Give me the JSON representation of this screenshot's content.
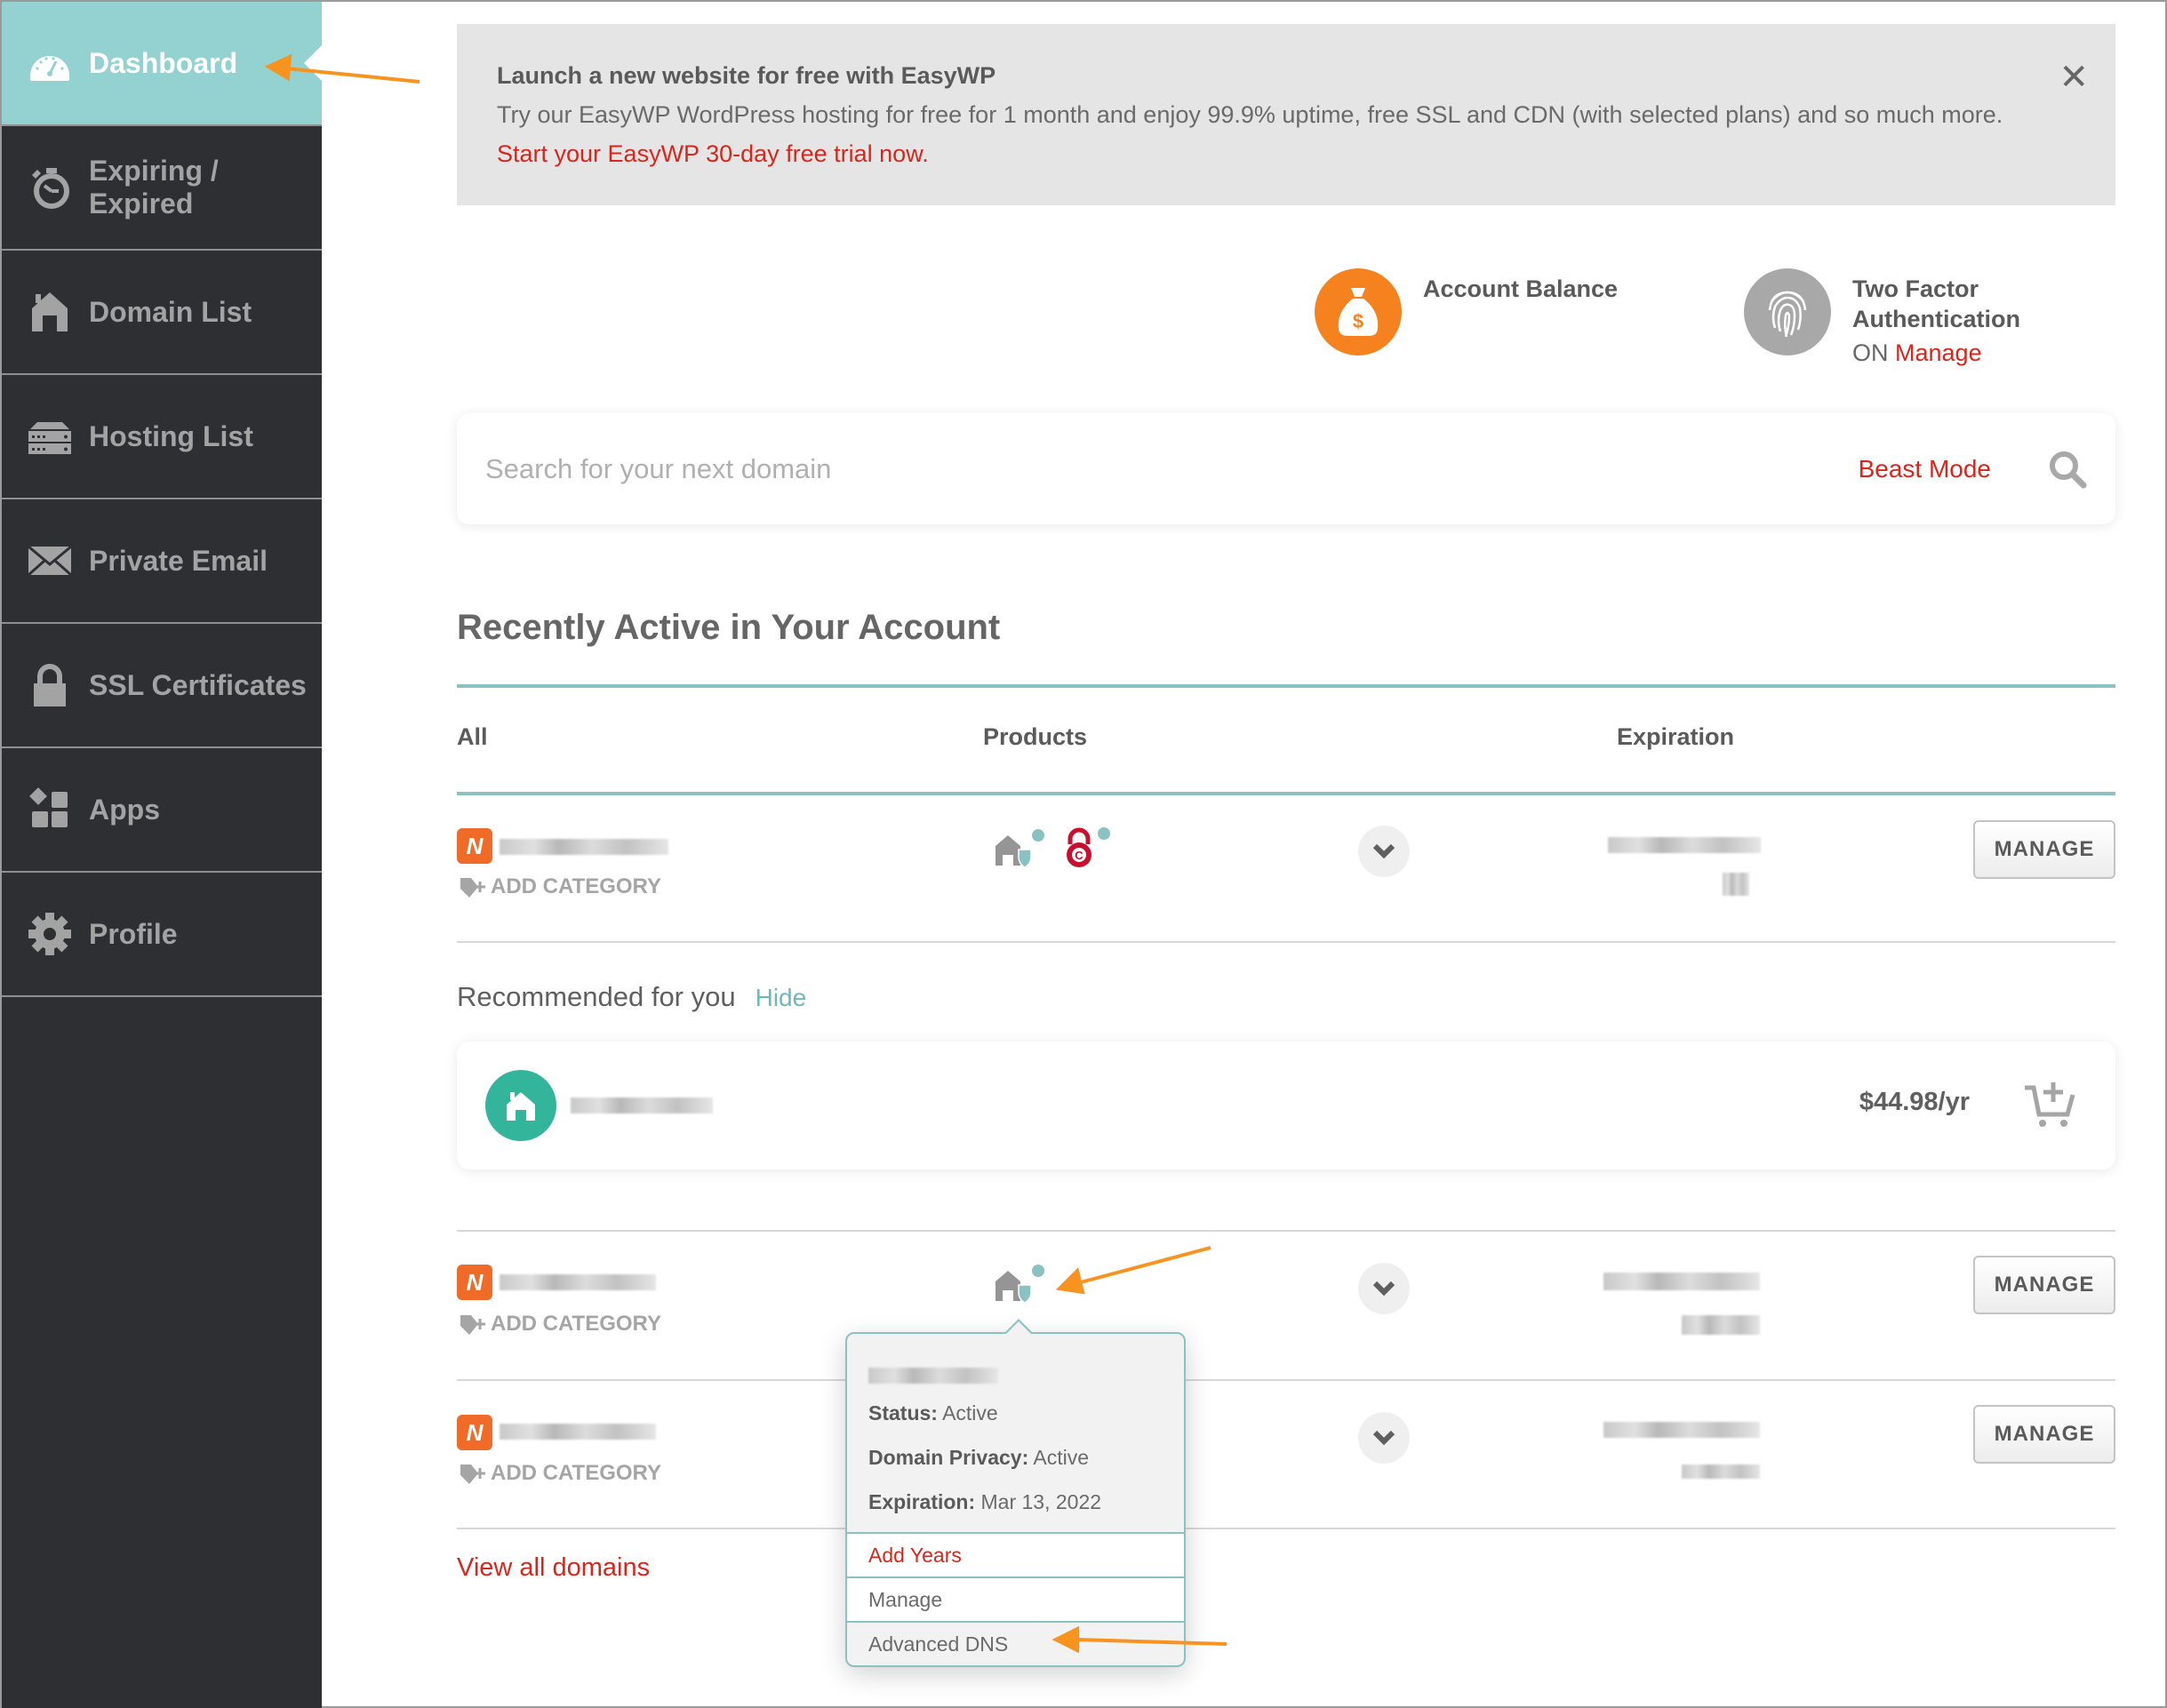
{
  "sidebar": {
    "items": [
      {
        "label": "Dashboard",
        "icon": "dashboard-gauge-icon",
        "active": true
      },
      {
        "label": "Expiring / Expired",
        "icon": "stopwatch-icon"
      },
      {
        "label": "Domain List",
        "icon": "house-icon"
      },
      {
        "label": "Hosting List",
        "icon": "server-icon"
      },
      {
        "label": "Private Email",
        "icon": "envelope-icon"
      },
      {
        "label": "SSL Certificates",
        "icon": "lock-icon"
      },
      {
        "label": "Apps",
        "icon": "apps-grid-icon"
      },
      {
        "label": "Profile",
        "icon": "gear-icon"
      }
    ]
  },
  "banner": {
    "title": "Launch a new website for free with EasyWP",
    "text": "Try our EasyWP WordPress hosting for free for 1 month and enjoy 99.9% uptime, free SSL and CDN (with selected plans) and so much more.",
    "link": "Start your EasyWP 30-day free trial now.",
    "close": "✕"
  },
  "stats": {
    "balance": {
      "label": "Account Balance",
      "icon": "money-bag-icon",
      "color": "#f5821f"
    },
    "two_factor": {
      "label_line1": "Two Factor",
      "label_line2": "Authentication",
      "status": "ON",
      "link": "Manage",
      "icon": "fingerprint-icon",
      "color": "#a8a8a8"
    }
  },
  "search": {
    "placeholder": "Search for your next domain",
    "value": "",
    "beast_mode": "Beast Mode"
  },
  "recent": {
    "title": "Recently Active in Your Account",
    "columns": [
      "All",
      "Products",
      "Expiration"
    ],
    "rows": [
      {
        "add_category": "ADD CATEGORY",
        "products": [
          "domain-privacy-icon",
          "ssl-icon"
        ],
        "manage": "MANAGE"
      },
      {
        "add_category": "ADD CATEGORY",
        "products": [
          "domain-privacy-icon"
        ],
        "manage": "MANAGE"
      },
      {
        "add_category": "ADD CATEGORY",
        "products": [],
        "manage": "MANAGE"
      }
    ],
    "view_all": "View all domains"
  },
  "recommended": {
    "title": "Recommended for you",
    "hide": "Hide",
    "price": "$44.98/yr"
  },
  "popover": {
    "status_label": "Status:",
    "status_value": "Active",
    "privacy_label": "Domain Privacy:",
    "privacy_value": "Active",
    "expiration_label": "Expiration:",
    "expiration_value": "Mar 13, 2022",
    "actions": [
      "Add Years",
      "Manage",
      "Advanced DNS"
    ]
  },
  "colors": {
    "accent_teal": "#94d1d1",
    "sidebar_bg": "#2e2f33",
    "link_red": "#d9261c",
    "annotation_orange": "#f7931e"
  }
}
